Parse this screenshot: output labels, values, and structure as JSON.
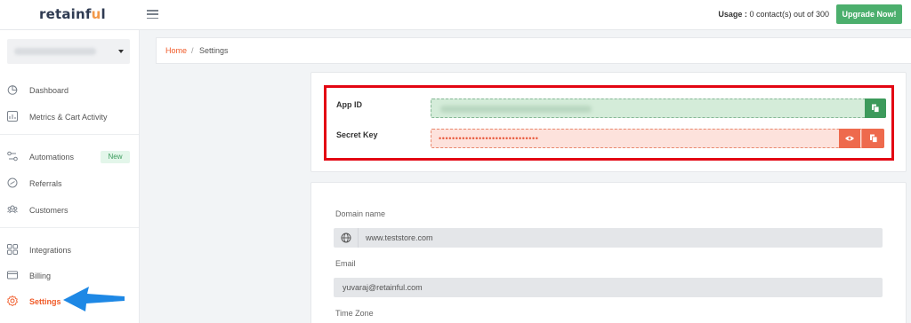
{
  "header": {
    "logo_main": "retainf",
    "logo_accent": "u",
    "logo_end": "l",
    "usage_label": "Usage :",
    "usage_value": " 0 contact(s) out of 300",
    "upgrade_label": "Upgrade Now!"
  },
  "sidebar": {
    "items": [
      {
        "label": "Dashboard",
        "icon": "dashboard-icon"
      },
      {
        "label": "Metrics & Cart Activity",
        "icon": "metrics-icon"
      },
      {
        "label": "Automations",
        "icon": "automations-icon",
        "badge": "New"
      },
      {
        "label": "Referrals",
        "icon": "referrals-icon"
      },
      {
        "label": "Customers",
        "icon": "customers-icon"
      },
      {
        "label": "Integrations",
        "icon": "integrations-icon"
      },
      {
        "label": "Billing",
        "icon": "billing-icon"
      },
      {
        "label": "Settings",
        "icon": "settings-icon",
        "active": true
      }
    ]
  },
  "breadcrumb": {
    "home": "Home",
    "separator": "/",
    "current": "Settings"
  },
  "keys": {
    "app_id_label": "App ID",
    "secret_key_label": "Secret Key",
    "secret_key_masked": "••••••••••••••••••••••••••••••"
  },
  "store": {
    "domain_label": "Domain name",
    "domain_value": "www.teststore.com",
    "email_label": "Email",
    "email_value": "yuvaraj@retainful.com",
    "timezone_label": "Time Zone"
  },
  "colors": {
    "brand_orange": "#f05a28",
    "upgrade_green": "#4caf6d",
    "annotation_red": "#e30613",
    "annotation_arrow": "#1e88e5"
  }
}
